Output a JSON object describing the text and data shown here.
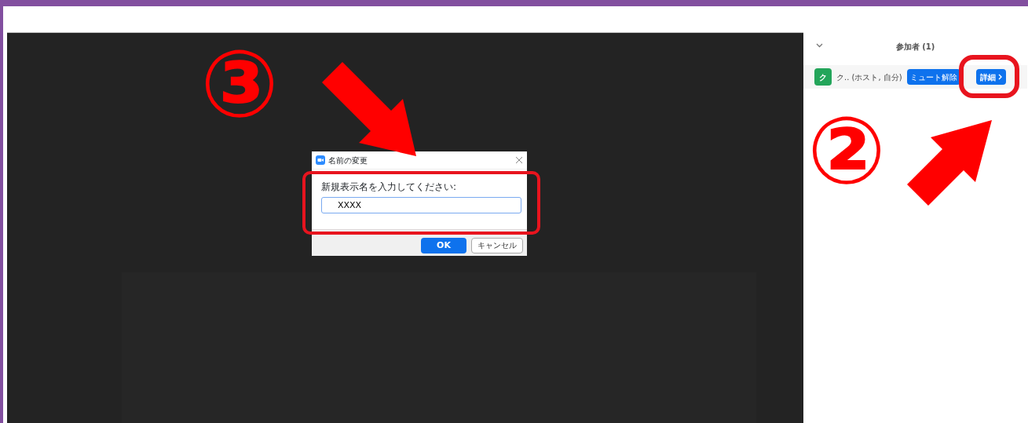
{
  "dialog": {
    "title": "名前の変更",
    "label": "新規表示名を入力してください:",
    "value": "XXXX",
    "buttons": [
      {
        "label": "OK",
        "kind": "primary"
      },
      {
        "label": "キャンセル",
        "kind": "secondary"
      }
    ]
  },
  "participants_panel": {
    "title": "参加者 (1)",
    "participants": [
      {
        "initial": "ク",
        "name": "ク.. (ホスト, 自分)",
        "mute_button": "ミュート解除",
        "details_button": "詳細"
      }
    ]
  },
  "annotations": [
    {
      "text": "③"
    },
    {
      "text": "②"
    }
  ]
}
